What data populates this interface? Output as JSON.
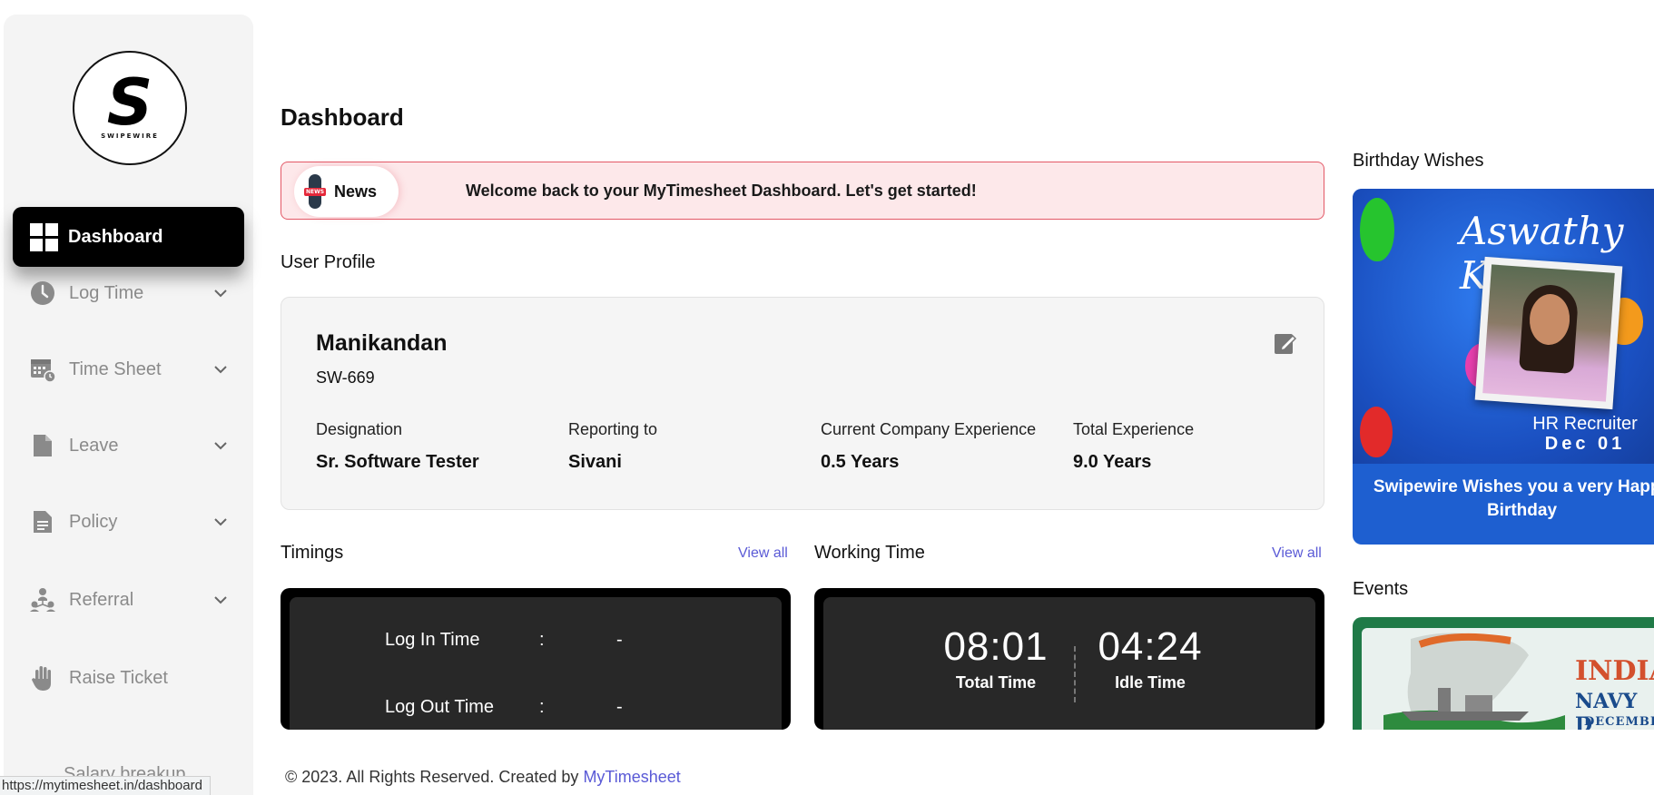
{
  "brand": {
    "logo_letter": "S",
    "logo_word": "SWIPEWIRE"
  },
  "sidebar": {
    "active": {
      "label": "Dashboard",
      "icon": "dashboard-icon"
    },
    "items": [
      {
        "label": "Log Time",
        "icon": "clock-icon",
        "expandable": true
      },
      {
        "label": "Time Sheet",
        "icon": "calendar-icon",
        "expandable": true
      },
      {
        "label": "Leave",
        "icon": "document-icon",
        "expandable": true
      },
      {
        "label": "Policy",
        "icon": "policy-icon",
        "expandable": true
      },
      {
        "label": "Referral",
        "icon": "referral-icon",
        "expandable": true
      },
      {
        "label": "Raise Ticket",
        "icon": "hand-icon",
        "expandable": false
      },
      {
        "label": "Salary breakup",
        "icon": "salary-icon",
        "expandable": false
      }
    ]
  },
  "header": {
    "title": "Dashboard"
  },
  "news": {
    "label": "News",
    "badge": "NEWS",
    "message": "Welcome back to your MyTimesheet Dashboard. Let's get started!"
  },
  "profile": {
    "section_title": "User Profile",
    "name": "Manikandan",
    "employee_id": "SW-669",
    "fields": [
      {
        "label": "Designation",
        "value": "Sr. Software Tester"
      },
      {
        "label": "Reporting to",
        "value": "Sivani"
      },
      {
        "label": "Current Company Experience",
        "value": "0.5 Years"
      },
      {
        "label": "Total Experience",
        "value": "9.0 Years"
      }
    ]
  },
  "timings": {
    "title": "Timings",
    "view_all": "View all",
    "rows": [
      {
        "label": "Log In Time",
        "sep": ":",
        "value": "-"
      },
      {
        "label": "Log Out Time",
        "sep": ":",
        "value": "-"
      }
    ]
  },
  "working_time": {
    "title": "Working Time",
    "view_all": "View all",
    "total": {
      "value": "08:01",
      "label": "Total Time"
    },
    "idle": {
      "value": "04:24",
      "label": "Idle Time"
    }
  },
  "birthday": {
    "title": "Birthday Wishes",
    "name": "Aswathy KC",
    "role": "HR Recruiter",
    "date": "Dec 01",
    "message": "Swipewire Wishes you a very Happy Birthday"
  },
  "events": {
    "title": "Events",
    "line1": "INDIA",
    "line2": "NAVY D",
    "line3": "DECEMBER"
  },
  "footer": {
    "text": "© 2023. All Rights Reserved. Created by ",
    "link": "MyTimesheet"
  },
  "status_bar": {
    "url": "https://mytimesheet.in/dashboard"
  },
  "colors": {
    "accent": "#5a5ad6",
    "news_bg": "#fde8ea",
    "news_border": "#e35866",
    "birthday_blue": "#1e5fd0",
    "event_green": "#1f7a47"
  }
}
